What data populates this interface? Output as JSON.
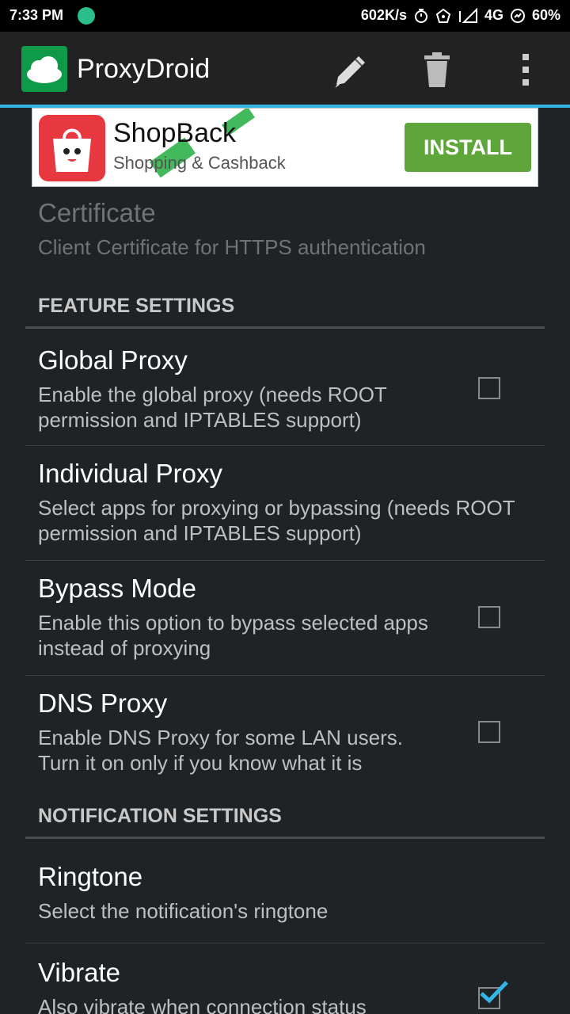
{
  "status_bar": {
    "time": "7:33 PM",
    "speed": "602K/s",
    "network": "4G",
    "battery": "60%"
  },
  "action_bar": {
    "title": "ProxyDroid",
    "icons": [
      "cloud-icon",
      "pencil-icon",
      "trash-icon",
      "overflow-menu-icon"
    ]
  },
  "ad": {
    "name": "ShopBack",
    "subtitle": "Shopping & Cashback",
    "install_label": "INSTALL"
  },
  "settings": {
    "certificate": {
      "title": "Certificate",
      "summary": "Client Certificate for HTTPS authentication",
      "enabled": false
    },
    "feature_header": "FEATURE SETTINGS",
    "global_proxy": {
      "title": "Global Proxy",
      "summary": "Enable the global proxy (needs ROOT permission and IPTABLES support)",
      "checked": false
    },
    "individual_proxy": {
      "title": "Individual Proxy",
      "summary": "Select apps for proxying or bypassing (needs ROOT permission and IPTABLES support)"
    },
    "bypass_mode": {
      "title": "Bypass Mode",
      "summary": "Enable this option to bypass selected apps instead of proxying",
      "checked": false
    },
    "dns_proxy": {
      "title": "DNS Proxy",
      "summary": "Enable DNS Proxy for some LAN users. Turn it on only if you know what it is",
      "checked": false
    },
    "notification_header": "NOTIFICATION SETTINGS",
    "ringtone": {
      "title": "Ringtone",
      "summary": "Select the notification's ringtone"
    },
    "vibrate": {
      "title": "Vibrate",
      "summary": "Also vibrate when connection status",
      "checked": true
    }
  },
  "colors": {
    "accent": "#33b5e5",
    "background": "#1f2326",
    "install_green": "#5fa63a"
  }
}
